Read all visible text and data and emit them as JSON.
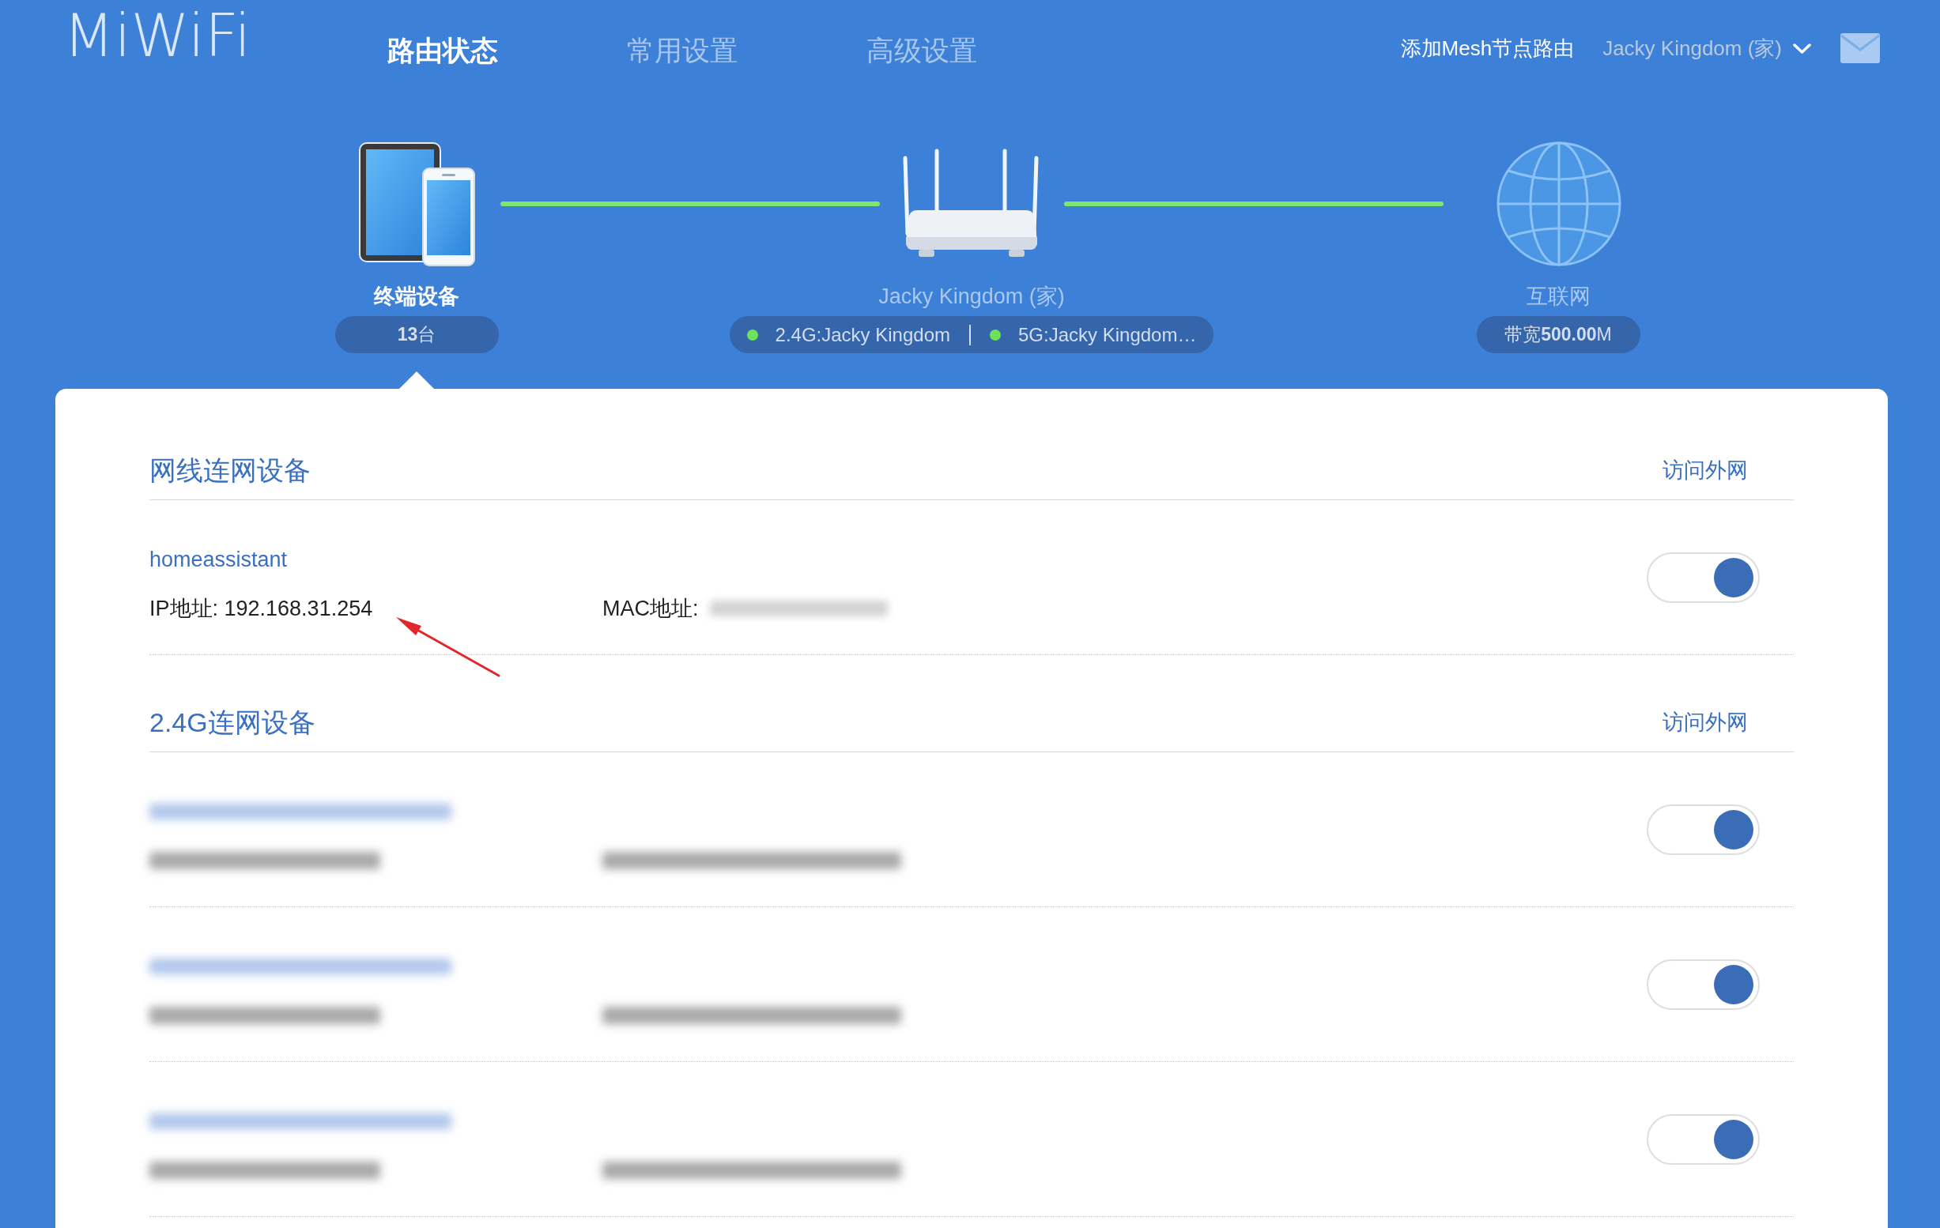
{
  "header": {
    "logo": "MiWiFi",
    "nav": [
      {
        "label": "路由状态",
        "selected": true
      },
      {
        "label": "常用设置",
        "selected": false
      },
      {
        "label": "高级设置",
        "selected": false
      }
    ],
    "add_mesh": "添加Mesh节点路由",
    "router_menu": "Jacky Kingdom (家)"
  },
  "topology": {
    "nodes": [
      {
        "kind": "devices",
        "label": "终端设备",
        "badge": "**13**台",
        "selected": true
      },
      {
        "kind": "router",
        "label": "Jacky Kingdom (家)",
        "networks": [
          {
            "label": "2.4G:Jacky Kingdom",
            "online": true
          },
          {
            "label": "5G:Jacky Kingdom…",
            "online": true
          }
        ],
        "selected": false
      },
      {
        "kind": "internet",
        "label": "互联网",
        "badge": "带宽**500.00**M",
        "selected": false
      }
    ],
    "links": [
      {
        "connected": true
      },
      {
        "connected": true
      }
    ]
  },
  "sections": [
    {
      "title": "网线连网设备",
      "action": "访问外网",
      "devices": [
        {
          "kind": "visible",
          "name": "homeassistant",
          "ip": "IP地址: 192.168.31.254",
          "mac_label": "MAC地址:",
          "mac_hidden": true,
          "on": true
        }
      ]
    },
    {
      "title": "2.4G连网设备",
      "action": "访问外网",
      "devices": [
        {
          "kind": "blurred",
          "on": true
        },
        {
          "kind": "blurred",
          "on": true
        },
        {
          "kind": "blurred",
          "on": true
        }
      ]
    }
  ]
}
